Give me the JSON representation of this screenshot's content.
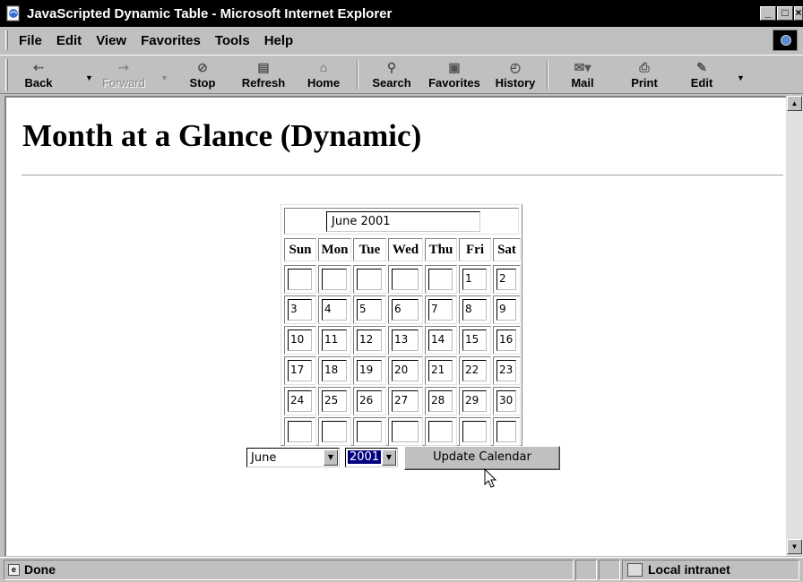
{
  "window": {
    "title": "JavaScripted Dynamic Table - Microsoft Internet Explorer"
  },
  "menu": [
    "File",
    "Edit",
    "View",
    "Favorites",
    "Tools",
    "Help"
  ],
  "toolbar": {
    "back": "Back",
    "forward": "Forward",
    "stop": "Stop",
    "refresh": "Refresh",
    "home": "Home",
    "search": "Search",
    "favorites": "Favorites",
    "history": "History",
    "mail": "Mail",
    "print": "Print",
    "edit": "Edit"
  },
  "page": {
    "title": "Month at a Glance (Dynamic)"
  },
  "calendar": {
    "month_display": "June 2001",
    "day_names": [
      "Sun",
      "Mon",
      "Tue",
      "Wed",
      "Thu",
      "Fri",
      "Sat"
    ],
    "weeks": [
      [
        "",
        "",
        "",
        "",
        "",
        "1",
        "2"
      ],
      [
        "3",
        "4",
        "5",
        "6",
        "7",
        "8",
        "9"
      ],
      [
        "10",
        "11",
        "12",
        "13",
        "14",
        "15",
        "16"
      ],
      [
        "17",
        "18",
        "19",
        "20",
        "21",
        "22",
        "23"
      ],
      [
        "24",
        "25",
        "26",
        "27",
        "28",
        "29",
        "30"
      ],
      [
        "",
        "",
        "",
        "",
        "",
        "",
        ""
      ]
    ]
  },
  "controls": {
    "month_select": "June",
    "year_select": "2001",
    "update_button": "Update Calendar"
  },
  "status": {
    "text": "Done",
    "zone": "Local intranet"
  }
}
